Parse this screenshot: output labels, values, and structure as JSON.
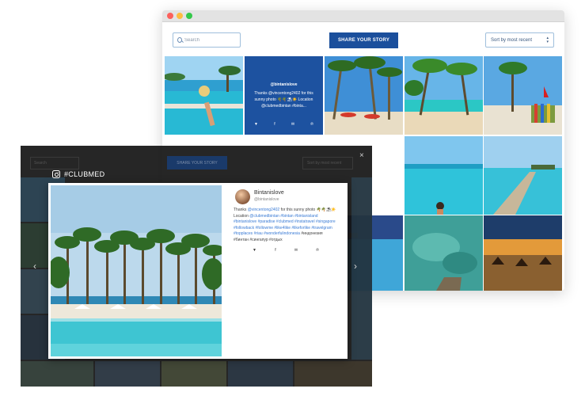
{
  "colors": {
    "brand_blue": "#1b4f9c",
    "featured_tile": "#1d52a0",
    "link_blue": "#3a7bd5",
    "overlay": "#161616"
  },
  "window": {
    "search_placeholder": "Search",
    "share_button": "SHARE YOUR STORY",
    "sort_label": "Sort by most recent"
  },
  "featured_post": {
    "user": "@bintanislove",
    "text": "Thanks @vincentong2402 for this sunny photo 🌴🌴⛱☀️ Location @clubmedbintan #binta...",
    "share_icons": [
      "twitter-icon",
      "facebook-icon",
      "mail-icon",
      "pinterest-icon"
    ]
  },
  "overlay": {
    "close_glyph": "×",
    "search_placeholder": "Search",
    "share_button": "SHARE YOUR STORY",
    "sort_label": "Sort by most recent",
    "brand_label": "#CLUBMED",
    "brand_icon": "instagram-icon",
    "prev_glyph": "‹",
    "next_glyph": "›"
  },
  "modal": {
    "user_name": "Bintanislove",
    "user_handle": "@bintanislove",
    "caption_prefix": "Thanks",
    "caption_mention": "@vincentong2402",
    "caption_middle": "for this sunny photo 🌴🌴⛱☀️Location",
    "caption_location": "@clubmedbintan",
    "hashtags": "#bintan #bintanisland #bintanislove #paradise #clubmed #instatravel #singapore #followback #followme #like4like #likeforlike #travelgram #topplaces #riau #wonderfulindonesia",
    "caption_suffix": "#индонезия #бинтан #сингапур #отдых",
    "share_icons": [
      "twitter-icon",
      "facebook-icon",
      "mail-icon",
      "pinterest-icon"
    ]
  }
}
